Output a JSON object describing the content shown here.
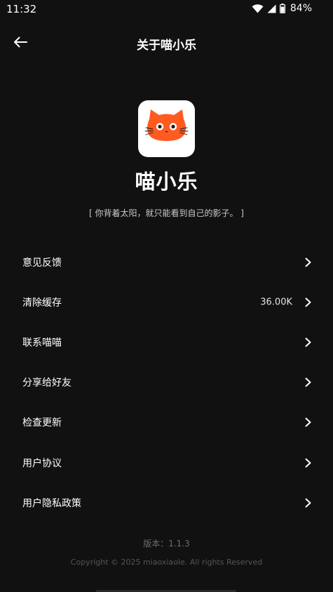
{
  "status_bar": {
    "time": "11:32",
    "battery_percent": "84%",
    "icons": [
      "wifi-icon",
      "signal-icon",
      "battery-icon"
    ]
  },
  "app_bar": {
    "title": "关于喵小乐",
    "back_icon": "arrow-left-icon"
  },
  "app": {
    "name": "喵小乐",
    "slogan": "[ 你背着太阳，就只能看到自己的影子。 ]",
    "logo_icon": "cat-face-icon",
    "logo_color": "#FF5A1F"
  },
  "menu": {
    "items": [
      {
        "label": "意见反馈",
        "value": ""
      },
      {
        "label": "清除缓存",
        "value": "36.00K"
      },
      {
        "label": "联系喵喵",
        "value": ""
      },
      {
        "label": "分享给好友",
        "value": ""
      },
      {
        "label": "检查更新",
        "value": ""
      },
      {
        "label": "用户协议",
        "value": ""
      },
      {
        "label": "用户隐私政策",
        "value": ""
      }
    ]
  },
  "footer": {
    "version": "版本：1.1.3",
    "copyright": "Copyright © 2025 miaoxiaole. All rights Reserved"
  },
  "colors": {
    "background": "#111112",
    "text": "#FFFFFF",
    "accent": "#FF5A1F"
  }
}
